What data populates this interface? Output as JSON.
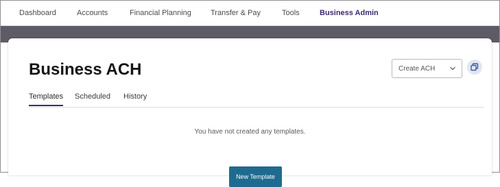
{
  "nav": {
    "items": [
      {
        "label": "Dashboard",
        "active": false
      },
      {
        "label": "Accounts",
        "active": false
      },
      {
        "label": "Financial Planning",
        "active": false
      },
      {
        "label": "Transfer & Pay",
        "active": false
      },
      {
        "label": "Tools",
        "active": false
      },
      {
        "label": "Business Admin",
        "active": true
      }
    ]
  },
  "page": {
    "title": "Business ACH",
    "create_select": {
      "selected": "Create ACH",
      "icon": "chevron-down-icon"
    },
    "copy_button": {
      "icon": "copy-icon"
    },
    "tabs": [
      {
        "label": "Templates",
        "active": true
      },
      {
        "label": "Scheduled",
        "active": false
      },
      {
        "label": "History",
        "active": false
      }
    ],
    "empty_message": "You have not created any templates.",
    "new_template_label": "New Template"
  },
  "colors": {
    "accent": "#3b2a6e",
    "band": "#5f5b66",
    "primary_button": "#1f6b8f"
  }
}
